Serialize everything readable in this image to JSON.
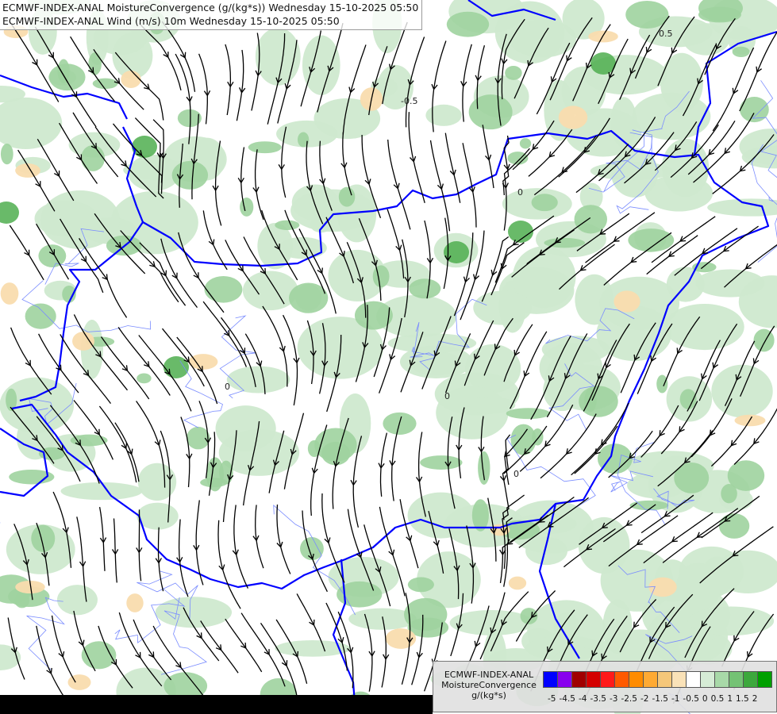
{
  "title": {
    "line1": "ECMWF-INDEX-ANAL MoistureConvergence (g/(kg*s)) Wednesday 15-10-2025 05:50",
    "line2": "ECMWF-INDEX-ANAL Wind (m/s) 10m Wednesday 15-10-2025 05:50"
  },
  "legend": {
    "line1": "ECMWF-INDEX-ANAL",
    "line2": "MoistureConvergence",
    "line3": "g/(kg*s)",
    "colors": [
      "#0000ff",
      "#8800ee",
      "#a00000",
      "#d40000",
      "#ff1a1a",
      "#ff5a00",
      "#ff8c00",
      "#ffaa33",
      "#f5c77a",
      "#fae2b8",
      "#ffffff",
      "#d6ecd6",
      "#a8d9a8",
      "#74c274",
      "#3ca83c",
      "#00a000"
    ],
    "ticks": [
      "-5",
      "-4.5",
      "-4",
      "-3.5",
      "-3",
      "-2.5",
      "-2",
      "-1.5",
      "-1",
      "-0.5",
      "0",
      "0.5",
      "1",
      "1.5",
      "2"
    ]
  },
  "contour_labels": [
    "-0.5",
    "0.5",
    "0"
  ],
  "colors": {
    "border": "#0000ff",
    "river": "#7a8cff",
    "streamline": "#000000",
    "green_light": "#cfe9cf",
    "green_mid": "#9ed39e",
    "green_dark": "#4fae4f",
    "orange_light": "#f9dcae"
  }
}
